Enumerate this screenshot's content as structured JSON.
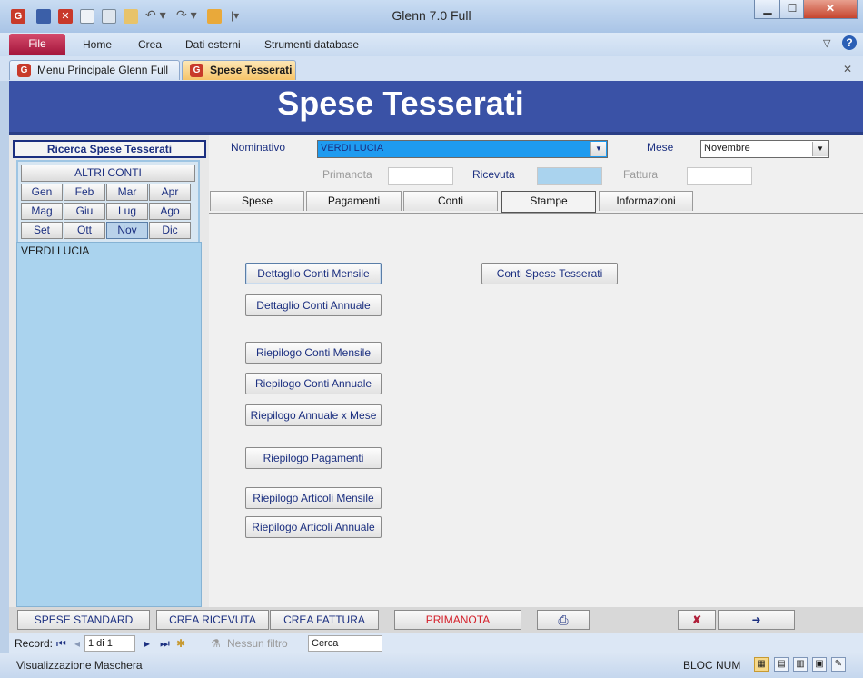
{
  "window": {
    "title": "Glenn 7.0 Full",
    "minimize": "▁",
    "maximize": "☐",
    "close": "✕"
  },
  "ribbon": {
    "file": "File",
    "tabs": [
      "Home",
      "Crea",
      "Dati esterni",
      "Strumenti database"
    ],
    "help": "?",
    "collapse": "▽"
  },
  "doc_tabs": [
    {
      "label": "Menu Principale Glenn Full",
      "icon": "G"
    },
    {
      "label": "Spese Tesserati",
      "icon": "G"
    }
  ],
  "doc_tabs_close": "✕",
  "form": {
    "title": "Spese Tesserati"
  },
  "left": {
    "search_title": "Ricerca Spese Tesserati",
    "altri_conti": "ALTRI CONTI",
    "months": [
      "Gen",
      "Feb",
      "Mar",
      "Apr",
      "Mag",
      "Giu",
      "Lug",
      "Ago",
      "Set",
      "Ott",
      "Nov",
      "Dic"
    ],
    "selected_month": "Nov",
    "names": [
      "VERDI LUCIA"
    ]
  },
  "fields": {
    "nominativo_label": "Nominativo",
    "nominativo_value": "VERDI LUCIA",
    "mese_label": "Mese",
    "mese_value": "Novembre",
    "primanota_label": "Primanota",
    "ricevuta_label": "Ricevuta",
    "fattura_label": "Fattura"
  },
  "tabs": [
    "Spese",
    "Pagamenti",
    "Conti",
    "Stampe",
    "Informazioni"
  ],
  "selected_tab": "Stampe",
  "report_buttons": {
    "dettaglio_mensile": "Dettaglio Conti Mensile",
    "dettaglio_annuale": "Dettaglio Conti Annuale",
    "riepilogo_mensile": "Riepilogo Conti Mensile",
    "riepilogo_annuale": "Riepilogo Conti Annuale",
    "riepilogo_annuale_mese": "Riepilogo Annuale x Mese",
    "riepilogo_pagamenti": "Riepilogo Pagamenti",
    "articoli_mensile": "Riepilogo Articoli Mensile",
    "articoli_annuale": "Riepilogo Articoli Annuale",
    "conti_spese": "Conti Spese Tesserati"
  },
  "bottom_buttons": {
    "spese_standard": "SPESE STANDARD",
    "crea_ricevuta": "CREA RICEVUTA",
    "crea_fattura": "CREA FATTURA",
    "primanota": "PRIMANOTA"
  },
  "record_nav": {
    "label": "Record:",
    "position": "1 di 1",
    "filter": "Nessun filtro",
    "search": "Cerca"
  },
  "status": {
    "mode": "Visualizzazione Maschera",
    "num_lock": "BLOC NUM"
  },
  "colors": {
    "header_blue": "#3a52a6",
    "file_tab": "#b81f46",
    "primanota_text": "#d4202a",
    "list_bg": "#aad3ee"
  }
}
